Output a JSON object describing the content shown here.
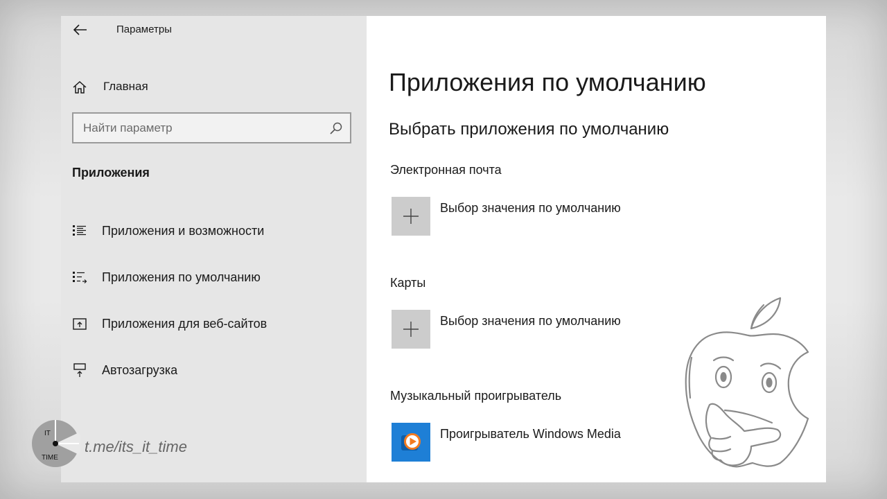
{
  "window": {
    "title": "Параметры"
  },
  "nav": {
    "home_label": "Главная",
    "search": {
      "placeholder": "Найти параметр",
      "value": ""
    },
    "section_title": "Приложения",
    "items": [
      {
        "label": "Приложения и возможности",
        "icon": "apps-list-icon"
      },
      {
        "label": "Приложения по умолчанию",
        "icon": "default-apps-icon"
      },
      {
        "label": "Приложения для веб-сайтов",
        "icon": "web-apps-icon"
      },
      {
        "label": "Автозагрузка",
        "icon": "startup-icon"
      }
    ]
  },
  "main": {
    "title": "Приложения по умолчанию",
    "subtitle": "Выбрать приложения по умолчанию",
    "categories": [
      {
        "label": "Электронная почта",
        "app_label": "Выбор значения по умолчанию",
        "icon": "plus-icon"
      },
      {
        "label": "Карты",
        "app_label": "Выбор значения по умолчанию",
        "icon": "plus-icon"
      },
      {
        "label": "Музыкальный проигрыватель",
        "app_label": "Проигрыватель Windows Media",
        "icon": "windows-media-player-icon"
      }
    ]
  },
  "watermark": {
    "logo_top": "IT",
    "logo_bottom": "TIME",
    "url": "t.me/its_it_time"
  },
  "colors": {
    "nav_bg": "#e6e6e6",
    "content_bg": "#ffffff",
    "tile_bg": "#cccccc",
    "media_tile": "#1e7fd6",
    "media_play": "#f47b20"
  }
}
